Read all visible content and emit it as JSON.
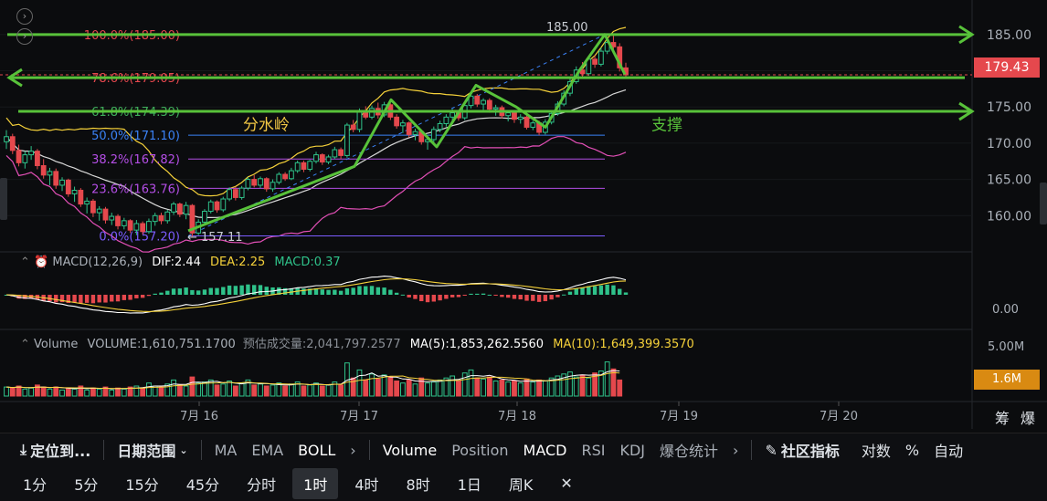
{
  "price_axis": {
    "ticks": [
      "185.00",
      "180.00",
      "175.00",
      "170.00",
      "165.00",
      "160.00"
    ],
    "current_price": "179.43",
    "current_price_color": "#e5484d"
  },
  "fib_levels": [
    {
      "label": "100.0%(185.00)",
      "value": 185.0,
      "color": "#e5484d"
    },
    {
      "label": "78.6%(179.05)",
      "value": 179.05,
      "color": "#e5484d"
    },
    {
      "label": "61.8%(174.39)",
      "value": 174.39,
      "color": "#3fae5a"
    },
    {
      "label": "50.0%(171.10)",
      "value": 171.1,
      "color": "#3b82f6"
    },
    {
      "label": "38.2%(167.82)",
      "value": 167.82,
      "color": "#b44ee6"
    },
    {
      "label": "23.6%(163.76)",
      "value": 163.76,
      "color": "#b44ee6"
    },
    {
      "label": "0.0%(157.20)",
      "value": 157.2,
      "color": "#7c5cff"
    }
  ],
  "annotations": {
    "watershed": "分水岭",
    "support": "支撑",
    "high_label": "185.00",
    "low_label": "← 157.11"
  },
  "macd": {
    "label": "MACD(12,26,9)",
    "dif": "DIF:2.44",
    "dea": "DEA:2.25",
    "macd": "MACD:0.37",
    "zero_tick": "0.00"
  },
  "volume": {
    "label": "Volume",
    "volume": "VOLUME:1,610,751.1700",
    "est": "预估成交量:2,041,797.2577",
    "ma5": "MA(5):1,853,262.5560",
    "ma10": "MA(10):1,649,399.3570",
    "tick": "5.00M",
    "current": "1.6M"
  },
  "date_axis": [
    "7月 16",
    "7月 17",
    "7月 18",
    "7月 19",
    "7月 20"
  ],
  "corner_icons": [
    "筹",
    "爆"
  ],
  "toolbar1": {
    "locate": "定位到...",
    "date_range": "日期范围",
    "overlays": [
      "MA",
      "EMA",
      "BOLL"
    ],
    "indicators": [
      "Volume",
      "Position",
      "MACD",
      "RSI",
      "KDJ",
      "爆仓统计"
    ],
    "community": "社区指标",
    "right": [
      "对数",
      "%",
      "自动"
    ]
  },
  "toolbar2": {
    "timeframes": [
      "1分",
      "5分",
      "15分",
      "45分",
      "分时",
      "1时",
      "4时",
      "8时",
      "1日",
      "周K"
    ],
    "active": "1时"
  },
  "chart_data": {
    "type": "candlestick",
    "x_labels": [
      "7月 16",
      "7月 17",
      "7月 18",
      "7月 19",
      "7月 20"
    ],
    "price_range": [
      155.5,
      187.5
    ],
    "ohlc": [
      [
        170.2,
        171.8,
        169.2,
        170.9
      ],
      [
        170.9,
        171.3,
        168.5,
        169.0
      ],
      [
        169.0,
        169.8,
        166.8,
        167.3
      ],
      [
        167.3,
        168.9,
        166.5,
        168.4
      ],
      [
        168.4,
        169.6,
        167.7,
        168.9
      ],
      [
        168.9,
        169.2,
        166.4,
        166.9
      ],
      [
        166.9,
        167.8,
        165.1,
        165.6
      ],
      [
        165.6,
        166.6,
        164.2,
        166.1
      ],
      [
        166.1,
        166.5,
        163.7,
        164.2
      ],
      [
        164.2,
        165.3,
        163.4,
        164.9
      ],
      [
        164.9,
        165.1,
        162.6,
        163.0
      ],
      [
        163.0,
        164.0,
        161.9,
        163.5
      ],
      [
        163.5,
        163.8,
        161.2,
        161.6
      ],
      [
        161.6,
        162.5,
        160.3,
        162.0
      ],
      [
        162.0,
        162.3,
        159.8,
        160.4
      ],
      [
        160.4,
        161.3,
        159.3,
        160.9
      ],
      [
        160.9,
        161.2,
        158.9,
        159.4
      ],
      [
        159.4,
        160.4,
        158.7,
        159.9
      ],
      [
        159.9,
        160.2,
        158.1,
        158.6
      ],
      [
        158.6,
        159.7,
        158.1,
        159.3
      ],
      [
        159.3,
        159.5,
        157.6,
        158.0
      ],
      [
        158.0,
        159.4,
        157.3,
        158.9
      ],
      [
        158.9,
        159.2,
        157.4,
        157.8
      ],
      [
        157.8,
        159.6,
        157.5,
        159.2
      ],
      [
        159.2,
        160.4,
        158.6,
        160.0
      ],
      [
        160.0,
        160.4,
        158.8,
        159.3
      ],
      [
        159.3,
        160.8,
        158.9,
        160.5
      ],
      [
        160.5,
        161.9,
        160.1,
        161.6
      ],
      [
        161.6,
        161.8,
        159.8,
        160.2
      ],
      [
        160.2,
        161.9,
        159.5,
        161.4
      ],
      [
        161.4,
        161.6,
        157.1,
        157.6
      ],
      [
        157.6,
        159.5,
        157.3,
        159.1
      ],
      [
        159.1,
        160.9,
        158.8,
        160.6
      ],
      [
        160.6,
        162.2,
        160.3,
        161.9
      ],
      [
        161.9,
        162.1,
        160.4,
        160.8
      ],
      [
        160.8,
        162.6,
        160.5,
        162.3
      ],
      [
        162.3,
        163.9,
        162.0,
        163.6
      ],
      [
        163.6,
        164.0,
        162.1,
        162.5
      ],
      [
        162.5,
        164.1,
        162.2,
        163.8
      ],
      [
        163.8,
        165.3,
        163.5,
        165.0
      ],
      [
        165.0,
        165.6,
        163.9,
        164.2
      ],
      [
        164.2,
        165.4,
        163.8,
        165.1
      ],
      [
        165.1,
        165.3,
        163.3,
        163.7
      ],
      [
        163.7,
        165.0,
        163.3,
        164.6
      ],
      [
        164.6,
        166.0,
        164.3,
        165.7
      ],
      [
        165.7,
        166.0,
        164.8,
        165.1
      ],
      [
        165.1,
        166.6,
        164.9,
        166.2
      ],
      [
        166.2,
        167.6,
        165.9,
        167.3
      ],
      [
        167.3,
        167.6,
        166.0,
        166.4
      ],
      [
        166.4,
        167.7,
        166.1,
        167.5
      ],
      [
        167.5,
        168.8,
        167.2,
        168.4
      ],
      [
        168.4,
        168.6,
        167.0,
        167.4
      ],
      [
        167.4,
        168.4,
        167.1,
        168.1
      ],
      [
        168.1,
        169.5,
        167.8,
        169.1
      ],
      [
        169.1,
        169.4,
        167.8,
        168.3
      ],
      [
        168.3,
        172.8,
        168.0,
        172.5
      ],
      [
        172.5,
        173.2,
        171.5,
        171.9
      ],
      [
        171.9,
        174.8,
        171.5,
        174.3
      ],
      [
        174.3,
        175.1,
        173.3,
        173.6
      ],
      [
        173.6,
        175.2,
        173.3,
        174.8
      ],
      [
        174.8,
        175.6,
        173.4,
        173.9
      ],
      [
        173.9,
        175.7,
        173.6,
        175.3
      ],
      [
        175.3,
        175.5,
        173.2,
        173.6
      ],
      [
        173.6,
        174.0,
        172.0,
        172.4
      ],
      [
        172.4,
        173.2,
        171.4,
        172.8
      ],
      [
        172.8,
        173.0,
        170.8,
        171.2
      ],
      [
        171.2,
        172.0,
        170.4,
        171.6
      ],
      [
        171.6,
        171.8,
        169.8,
        170.2
      ],
      [
        170.2,
        170.9,
        169.1,
        170.5
      ],
      [
        170.5,
        172.3,
        170.1,
        171.9
      ],
      [
        171.9,
        173.1,
        171.5,
        172.7
      ],
      [
        172.7,
        174.0,
        172.3,
        173.6
      ],
      [
        173.6,
        174.7,
        172.9,
        174.2
      ],
      [
        174.2,
        174.5,
        173.1,
        173.5
      ],
      [
        173.5,
        175.6,
        173.2,
        175.2
      ],
      [
        175.2,
        177.0,
        174.8,
        176.5
      ],
      [
        176.5,
        176.8,
        175.0,
        175.4
      ],
      [
        175.4,
        176.2,
        174.6,
        175.9
      ],
      [
        175.9,
        176.2,
        174.2,
        174.7
      ],
      [
        174.7,
        175.3,
        173.8,
        174.9
      ],
      [
        174.9,
        175.2,
        173.4,
        173.8
      ],
      [
        173.8,
        174.5,
        173.0,
        174.2
      ],
      [
        174.2,
        174.4,
        172.8,
        173.3
      ],
      [
        173.3,
        174.0,
        172.7,
        173.6
      ],
      [
        173.6,
        173.9,
        171.9,
        172.2
      ],
      [
        172.2,
        173.1,
        171.8,
        172.8
      ],
      [
        172.8,
        173.1,
        171.1,
        171.5
      ],
      [
        171.5,
        173.3,
        171.2,
        172.9
      ],
      [
        172.9,
        174.4,
        172.6,
        174.1
      ],
      [
        174.1,
        175.8,
        173.8,
        175.4
      ],
      [
        175.4,
        177.3,
        175.1,
        176.9
      ],
      [
        176.9,
        178.9,
        176.5,
        178.5
      ],
      [
        178.5,
        180.6,
        178.2,
        180.1
      ],
      [
        180.1,
        181.2,
        179.2,
        179.6
      ],
      [
        179.6,
        182.0,
        179.3,
        181.6
      ],
      [
        181.6,
        182.1,
        180.4,
        180.9
      ],
      [
        180.9,
        183.2,
        180.6,
        182.7
      ],
      [
        182.7,
        184.2,
        182.3,
        183.9
      ],
      [
        183.9,
        185.0,
        182.8,
        183.3
      ],
      [
        183.3,
        183.8,
        179.9,
        180.4
      ],
      [
        180.4,
        181.1,
        179.0,
        179.43
      ]
    ],
    "volume": [
      0.9,
      0.8,
      1.0,
      0.7,
      0.8,
      1.1,
      0.9,
      0.7,
      0.9,
      0.6,
      0.8,
      0.7,
      1.0,
      0.6,
      0.8,
      0.7,
      0.9,
      0.6,
      0.8,
      0.7,
      0.9,
      1.0,
      0.8,
      1.3,
      1.0,
      0.9,
      1.2,
      1.6,
      1.1,
      1.0,
      1.9,
      1.3,
      1.4,
      1.6,
      1.1,
      1.2,
      1.5,
      1.0,
      1.3,
      1.6,
      1.1,
      1.2,
      1.0,
      1.1,
      1.3,
      1.0,
      1.2,
      1.4,
      1.0,
      1.1,
      1.3,
      1.0,
      1.1,
      1.4,
      1.1,
      3.3,
      1.8,
      2.6,
      1.6,
      2.2,
      1.7,
      2.1,
      1.9,
      1.5,
      1.3,
      1.6,
      1.2,
      1.8,
      1.3,
      1.4,
      1.6,
      1.8,
      2.0,
      1.5,
      2.3,
      2.6,
      1.8,
      1.7,
      1.9,
      1.5,
      1.6,
      1.4,
      1.5,
      1.3,
      1.7,
      1.4,
      1.6,
      1.5,
      1.8,
      2.0,
      2.2,
      2.4,
      1.9,
      2.1,
      1.8,
      2.3,
      2.5,
      3.4,
      2.7,
      1.6
    ],
    "fibonacci": [
      185.0,
      179.05,
      174.39,
      171.1,
      167.82,
      163.76,
      157.2
    ]
  }
}
